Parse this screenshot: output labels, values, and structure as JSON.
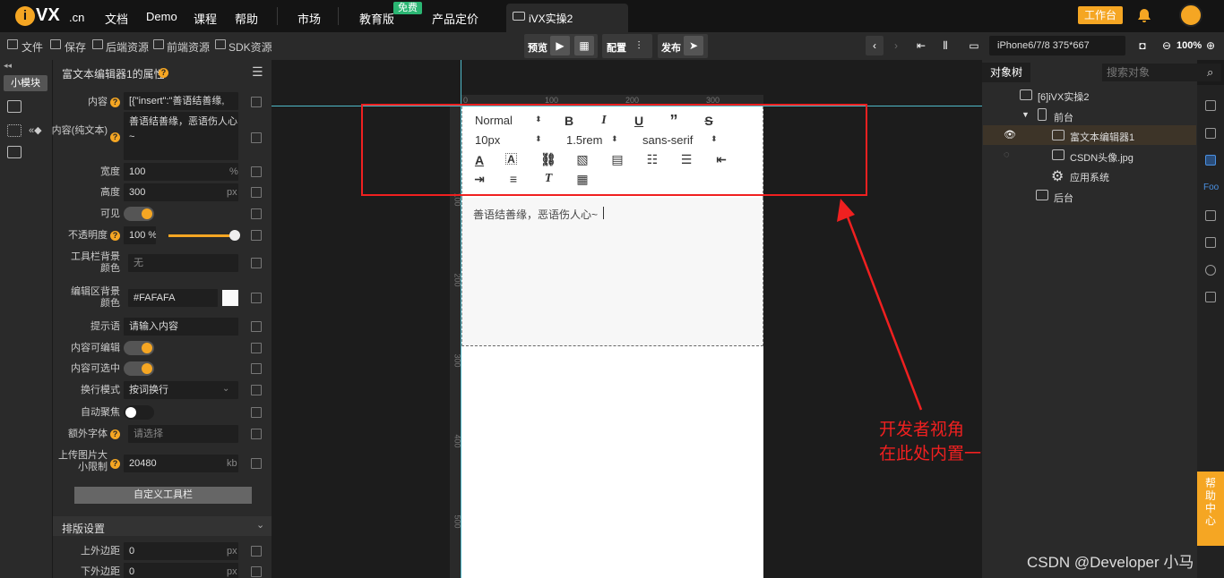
{
  "topnav": {
    "logo_letter": "i",
    "logo_text": "VX",
    "logo_domain": ".cn",
    "items": [
      "文档",
      "Demo",
      "课程",
      "帮助"
    ],
    "market": "市场",
    "edu": "教育版",
    "free_badge": "免费",
    "pricing": "产品定价",
    "tab_title": "iVX实操2",
    "workbench": "工作台"
  },
  "toolbar": {
    "file": "文件",
    "save": "保存",
    "backend": "后端资源",
    "frontend": "前端资源",
    "sdk": "SDK资源",
    "preview": "预览",
    "config": "配置",
    "publish": "发布",
    "device": "iPhone6/7/8 375*667",
    "zoom": "100%"
  },
  "left_strip": {
    "small_module": "小模块"
  },
  "props": {
    "header": "富文本编辑器1的属性",
    "rows": {
      "content_label": "内容",
      "content_value": "[{\"insert\":\"善语结善缘,",
      "content_plain_label": "内容(纯文本)",
      "content_plain_value": "善语结善缘，恶语伤人心~",
      "width_label": "宽度",
      "width_value": "100",
      "width_unit": "%",
      "height_label": "高度",
      "height_value": "300",
      "height_unit": "px",
      "visible_label": "可见",
      "opacity_label": "不透明度",
      "opacity_value": "100 %",
      "toolbar_bg_label": "工具栏背景颜色",
      "toolbar_bg_value": "无",
      "editor_bg_label": "编辑区背景颜色",
      "editor_bg_value": "#FAFAFA",
      "placeholder_label": "提示语",
      "placeholder_value": "请输入内容",
      "editable_label": "内容可编辑",
      "selectable_label": "内容可选中",
      "wrap_label": "换行模式",
      "wrap_value": "按词换行",
      "autofocus_label": "自动聚焦",
      "extra_font_label": "额外字体",
      "extra_font_value": "请选择",
      "upload_limit_label": "上传图片大小限制",
      "upload_limit_value": "20480",
      "upload_limit_unit": "kb",
      "custom_toolbar": "自定义工具栏",
      "layout_section": "排版设置",
      "margin_top_label": "上外边距",
      "margin_top_value": "0",
      "margin_top_unit": "px",
      "margin_bottom_label": "下外边距",
      "margin_bottom_value": "0",
      "margin_bottom_unit": "px"
    }
  },
  "canvas": {
    "ruler_top": [
      "0",
      "100",
      "200",
      "300"
    ],
    "ruler_left": [
      "100",
      "200",
      "300",
      "400",
      "500"
    ],
    "editor": {
      "header_select": "Normal",
      "size_select": "10px",
      "line_height_select": "1.5rem",
      "font_select": "sans-serif",
      "text": "善语结善缘，恶语伤人心~"
    },
    "annotation_line1": "开发者视角",
    "annotation_line2": "在此处内置一个富文本编辑器"
  },
  "right_panel": {
    "tab": "对象树",
    "search_placeholder": "搜索对象",
    "tree": [
      "[6]iVX实操2",
      "前台",
      "富文本编辑器1",
      "CSDN头像.jpg",
      "应用系统",
      "后台"
    ],
    "help": "帮助中心"
  },
  "watermark": "CSDN @Developer 小马"
}
